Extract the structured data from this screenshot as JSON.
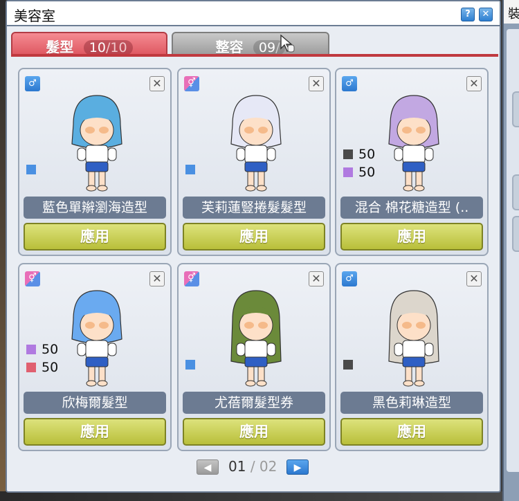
{
  "window": {
    "title": "美容室",
    "help_label": "?",
    "close_label": "✕"
  },
  "side_window": {
    "title_fragment": "裝"
  },
  "tabs": [
    {
      "label": "髮型",
      "current": "10",
      "separator": "/",
      "max": "10",
      "active": true
    },
    {
      "label": "整容",
      "current": "09",
      "separator": "/",
      "max": "",
      "active": false
    }
  ],
  "colors": {
    "accent_red": "#df5a63",
    "apply_green": "#c4ca48",
    "name_bar": "#6c7b92",
    "swatch_blue": "#4a90e2",
    "swatch_dark": "#4a4a4a",
    "swatch_purple": "#b07ae0",
    "swatch_red": "#e06070"
  },
  "cards": [
    {
      "gender": "male-icon",
      "name": "藍色單辮瀏海造型",
      "apply_label": "應用",
      "swatch": "blue",
      "hair": "#5aaee0"
    },
    {
      "gender": "unisex-icon",
      "name": "芙莉蓮豎捲髮髮型",
      "apply_label": "應用",
      "swatch": "blue",
      "hair": "#e6e8f6"
    },
    {
      "gender": "male-icon",
      "name": "混合 棉花糖造型 (..",
      "apply_label": "應用",
      "mix": [
        {
          "color": "dark",
          "value": "50"
        },
        {
          "color": "purple",
          "value": "50"
        }
      ],
      "hair": "#c2a8e2"
    },
    {
      "gender": "unisex-icon",
      "name": "欣梅爾髮型",
      "apply_label": "應用",
      "mix": [
        {
          "color": "purple",
          "value": "50"
        },
        {
          "color": "red",
          "value": "50"
        }
      ],
      "hair": "#6aaaf0"
    },
    {
      "gender": "unisex-icon",
      "name": "尤蓓爾髮型券",
      "apply_label": "應用",
      "swatch": "blue",
      "hair": "#6b8a3a"
    },
    {
      "gender": "male-icon",
      "name": "黑色莉琳造型",
      "apply_label": "應用",
      "swatch": "dark",
      "hair": "#dcd6cc"
    }
  ],
  "pager": {
    "current": "01",
    "separator": "/",
    "total": "02",
    "prev_label": "◀",
    "next_label": "▶"
  }
}
